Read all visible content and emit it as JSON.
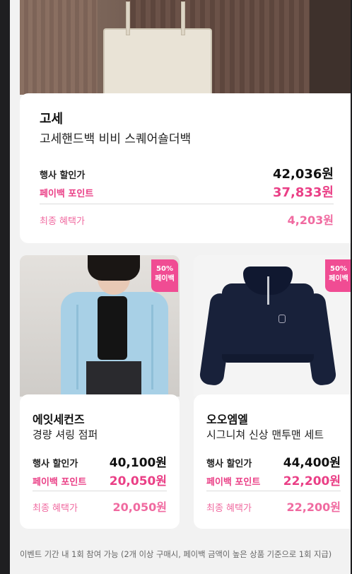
{
  "featured": {
    "brand": "고세",
    "product": "고세핸드백 비비 스퀘어숄더백",
    "event_label": "행사 할인가",
    "event_price": "42,036원",
    "point_label": "페이백 포인트",
    "point_value": "37,833원",
    "final_label": "최종 혜택가",
    "final_price": "4,203원"
  },
  "items": [
    {
      "badge_pct": "50%",
      "badge_text": "페이백",
      "brand": "에잇세컨즈",
      "product": "경량 셔링 점퍼",
      "event_label": "행사 할인가",
      "event_price": "40,100원",
      "point_label": "페이백 포인트",
      "point_value": "20,050원",
      "final_label": "최종 혜택가",
      "final_price": "20,050원"
    },
    {
      "badge_pct": "50%",
      "badge_text": "페이백",
      "brand": "오오엠엘",
      "product": "시그니쳐 신상 맨투맨 세트",
      "event_label": "행사 할인가",
      "event_price": "44,400원",
      "point_label": "페이백 포인트",
      "point_value": "22,200원",
      "final_label": "최종 혜택가",
      "final_price": "22,200원"
    }
  ],
  "notice": "이벤트 기간 내 1회 참여 가능 (2개 이상 구매시, 페이백 금액이 높은 상품 기준으로 1회 지급)",
  "colors": {
    "accent_pink": "#ea3f86",
    "badge_pink": "#f04c93",
    "background": "#f2f2f2",
    "card": "#ffffff"
  }
}
